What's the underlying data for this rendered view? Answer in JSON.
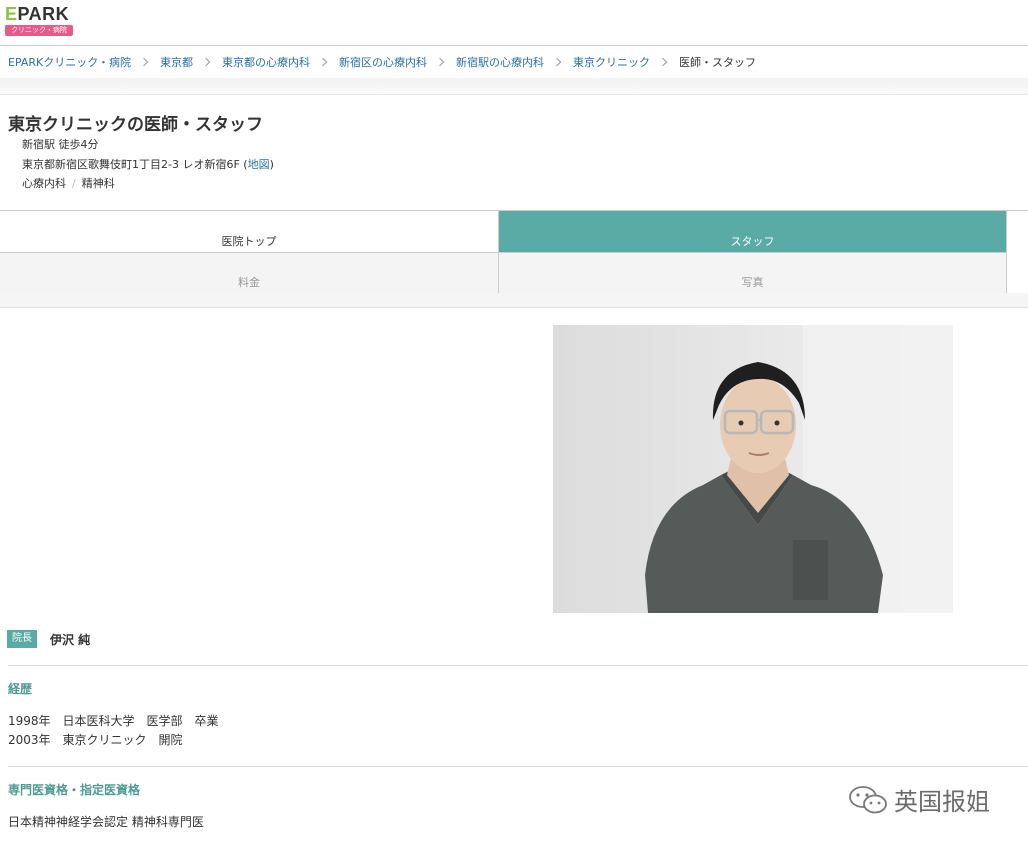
{
  "header": {
    "logo_text_e": "E",
    "logo_text_rest": "PARK",
    "logo_sub": "クリニック・病院"
  },
  "breadcrumb": [
    "EPARKクリニック・病院",
    "東京都",
    "東京都の心療内科",
    "新宿区の心療内科",
    "新宿駅の心療内科",
    "東京クリニック"
  ],
  "breadcrumb_current": "医師・スタッフ",
  "clinic": {
    "title": "東京クリニックの医師・スタッフ",
    "access": "新宿駅 徒歩4分",
    "address": "東京都新宿区歌舞伎町1丁目2-3 レオ新宿6F (",
    "map_link": "地図",
    "address_close": ")",
    "dept1": "心療内科",
    "dept_sep": "/",
    "dept2": "精神科"
  },
  "tabs": {
    "top": "医院トップ",
    "staff": "スタッフ",
    "fee": "料金",
    "photo": "写真"
  },
  "doctor": {
    "role": "院長",
    "name": "伊沢 純"
  },
  "career": {
    "title": "経歴",
    "items": [
      "1998年　日本医科大学　医学部　卒業",
      "2003年　東京クリニック　開院"
    ]
  },
  "qualification": {
    "title": "専門医資格・指定医資格",
    "items": [
      "日本精神神経学会認定 精神科専門医"
    ]
  },
  "watermark": "英国报姐",
  "colors": {
    "accent": "#5aaba5",
    "section_title": "#4d9a94",
    "link": "#2a6fa8"
  }
}
